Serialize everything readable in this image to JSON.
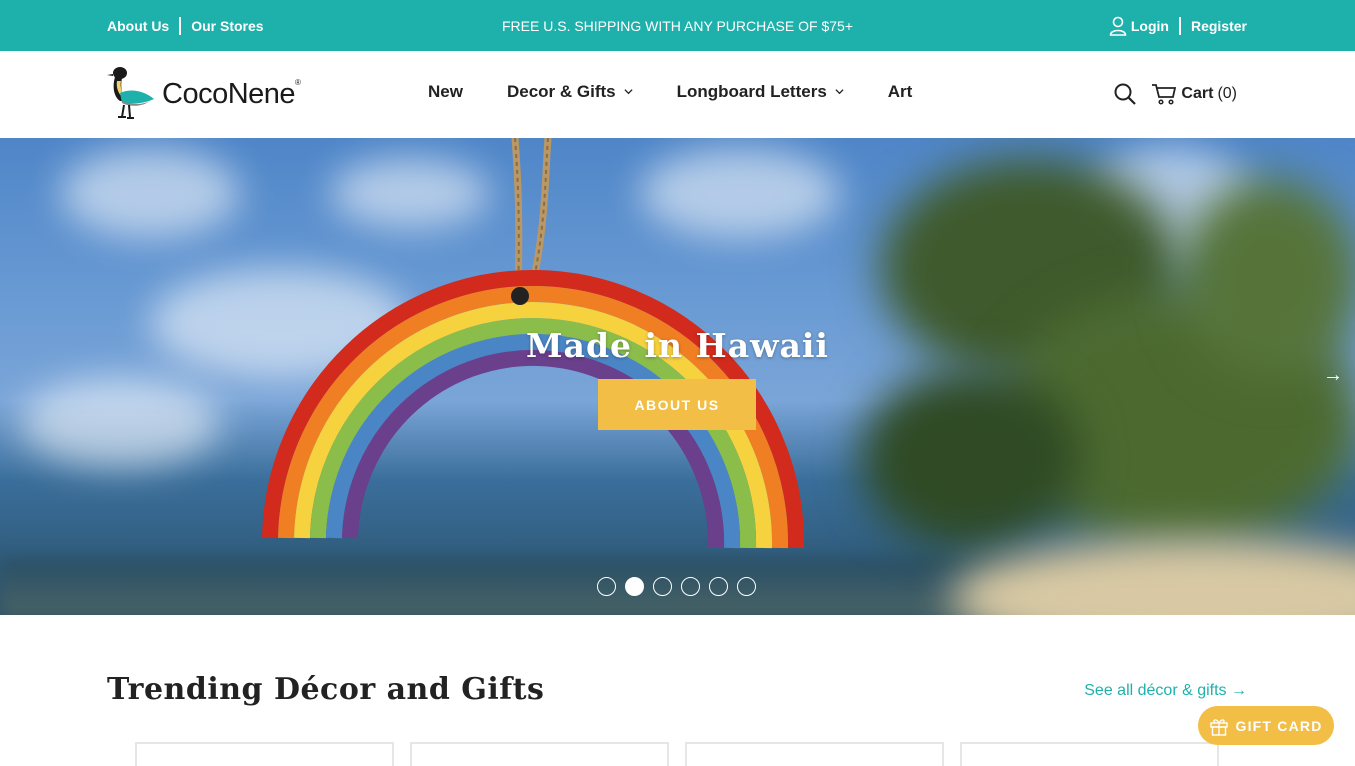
{
  "topbar": {
    "about_us": "About Us",
    "our_stores": "Our Stores",
    "promo": "FREE U.S. SHIPPING WITH ANY PURCHASE OF $75+",
    "login": "Login",
    "register": "Register",
    "bg_color": "#1eb1ab"
  },
  "header": {
    "logo_text": "CocoNene",
    "logo_reg": "®",
    "nav": [
      {
        "label": "New"
      },
      {
        "label": "Decor & Gifts"
      },
      {
        "label": "Longboard Letters"
      },
      {
        "label": "Art"
      }
    ],
    "cart_label": "Cart",
    "cart_count": "(0)"
  },
  "hero": {
    "title": "Made in Hawaii",
    "button": "ABOUT US",
    "next_arrow": "→",
    "slide_count": 6,
    "active_slide": 2,
    "button_color": "#f2be45"
  },
  "trending": {
    "title": "Trending Décor and Gifts",
    "see_all": "See all décor & gifts →"
  },
  "gift_card": {
    "label": "GIFT CARD",
    "color": "#f2be45"
  },
  "icons": [
    "user-icon",
    "search-icon",
    "cart-icon",
    "chevron-down-icon",
    "gift-icon",
    "arrow-right-icon",
    "logo-bird-icon"
  ]
}
